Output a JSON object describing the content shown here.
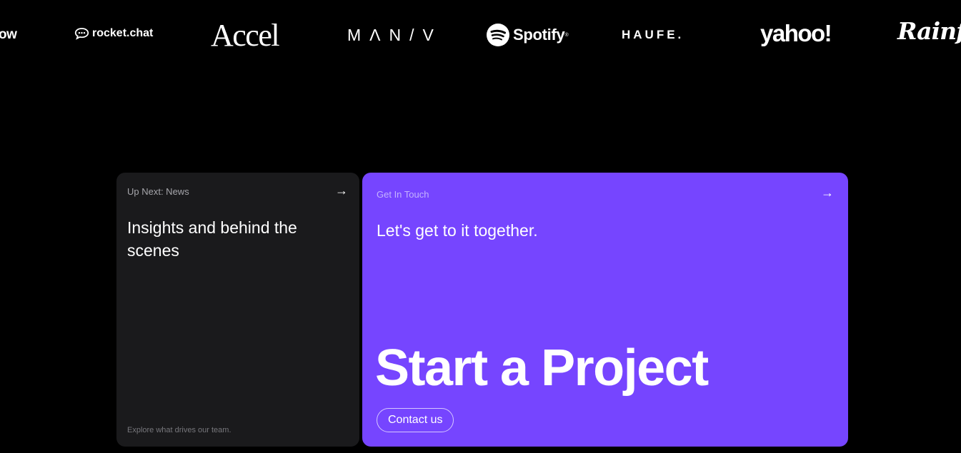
{
  "logos": [
    {
      "name": "partial-flow",
      "text": "ow"
    },
    {
      "name": "rocket-chat",
      "text": "rocket.chat"
    },
    {
      "name": "accel",
      "text": "Accel"
    },
    {
      "name": "maniv",
      "text": "MΛN/V"
    },
    {
      "name": "spotify",
      "text": "Spotify",
      "reg": "®"
    },
    {
      "name": "haufe",
      "text": "HAUFE."
    },
    {
      "name": "yahoo",
      "text": "yahoo!"
    },
    {
      "name": "rainfall",
      "text": "Rainfa"
    }
  ],
  "news_card": {
    "eyebrow": "Up Next: News",
    "arrow": "→",
    "heading": "Insights and behind the scenes",
    "footnote": "Explore what drives our team."
  },
  "contact_card": {
    "eyebrow": "Get In Touch",
    "arrow": "→",
    "heading": "Let's get to it together.",
    "big_title": "Start a Project",
    "button_label": "Contact us"
  },
  "colors": {
    "background": "#000000",
    "news_card_bg": "#1a1a1c",
    "contact_card_bg": "#7645ff",
    "text": "#ffffff"
  }
}
